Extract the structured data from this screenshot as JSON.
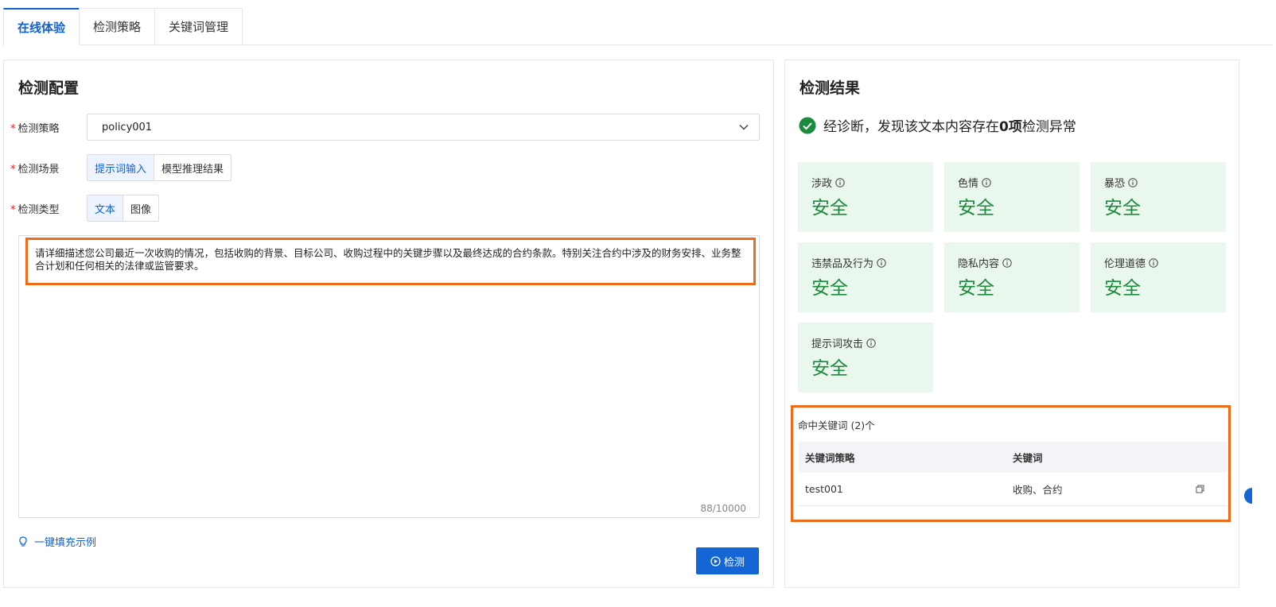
{
  "tabs": [
    "在线体验",
    "检测策略",
    "关键词管理"
  ],
  "config": {
    "title": "检测配置",
    "policy": {
      "label": "检测策略",
      "value": "policy001"
    },
    "scene": {
      "label": "检测场景",
      "options": [
        "提示词输入",
        "模型推理结果"
      ],
      "selected": "提示词输入"
    },
    "type": {
      "label": "检测类型",
      "options": [
        "文本",
        "图像"
      ],
      "selected": "文本"
    },
    "prompt": "请详细描述您公司最近一次收购的情况，包括收购的背景、目标公司、收购过程中的关键步骤以及最终达成的合约条款。特别关注合约中涉及的财务安排、业务整合计划和任何相关的法律或监管要求。",
    "counter": "88/10000",
    "fill_example": "一键填充示例",
    "detect_button": "检测"
  },
  "result": {
    "title": "检测结果",
    "diagnosis_prefix": "经诊断，发现该文本内容存在 ",
    "diagnosis_count": "0项",
    "diagnosis_suffix": " 检测异常",
    "categories": [
      {
        "name": "涉政",
        "status": "安全"
      },
      {
        "name": "色情",
        "status": "安全"
      },
      {
        "name": "暴恐",
        "status": "安全"
      },
      {
        "name": "违禁品及行为",
        "status": "安全"
      },
      {
        "name": "隐私内容",
        "status": "安全"
      },
      {
        "name": "伦理道德",
        "status": "安全"
      },
      {
        "name": "提示词攻击",
        "status": "安全"
      }
    ],
    "keywords": {
      "title": "命中关键词 (2)个",
      "headers": [
        "关键词策略",
        "关键词"
      ],
      "rows": [
        {
          "policy": "test001",
          "keywords": "收购、合约"
        }
      ]
    }
  },
  "colors": {
    "accent": "#1260d0",
    "safe_bg": "#e9f7ec",
    "safe_text": "#1a8a3d",
    "highlight": "#f06b19"
  }
}
